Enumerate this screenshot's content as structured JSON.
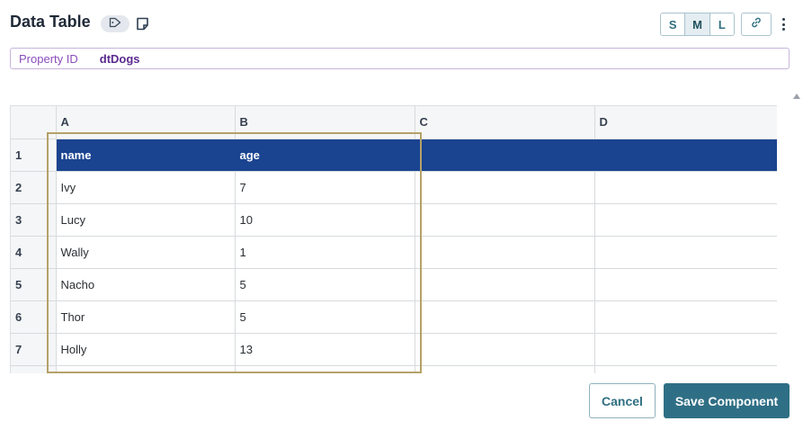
{
  "header": {
    "title": "Data Table",
    "size_options": [
      "S",
      "M",
      "L"
    ],
    "active_size": "M"
  },
  "property": {
    "label": "Property ID",
    "value": "dtDogs"
  },
  "sheet": {
    "column_headers": [
      "",
      "A",
      "B",
      "C",
      "D"
    ],
    "rows": [
      {
        "num": "1",
        "cells": [
          "name",
          "age",
          "",
          ""
        ]
      },
      {
        "num": "2",
        "cells": [
          "Ivy",
          "7",
          "",
          ""
        ]
      },
      {
        "num": "3",
        "cells": [
          "Lucy",
          "10",
          "",
          ""
        ]
      },
      {
        "num": "4",
        "cells": [
          "Wally",
          "1",
          "",
          ""
        ]
      },
      {
        "num": "5",
        "cells": [
          "Nacho",
          "5",
          "",
          ""
        ]
      },
      {
        "num": "6",
        "cells": [
          "Thor",
          "5",
          "",
          ""
        ]
      },
      {
        "num": "7",
        "cells": [
          "Holly",
          "13",
          "",
          ""
        ]
      },
      {
        "num": "",
        "cells": [
          "",
          "",
          "",
          ""
        ]
      }
    ]
  },
  "footer": {
    "cancel_label": "Cancel",
    "save_label": "Save Component"
  },
  "colors": {
    "header_row": "#1a4390",
    "primary_button": "#2f6f85",
    "highlight_border": "#b5a16a"
  }
}
